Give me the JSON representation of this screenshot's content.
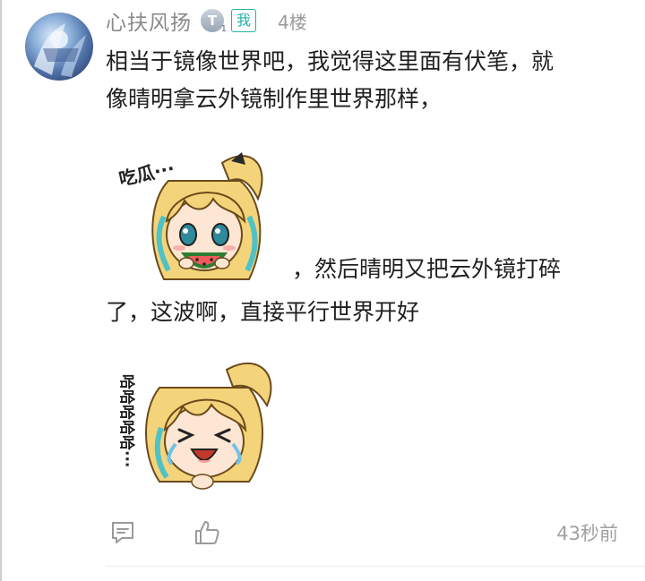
{
  "user": {
    "name": "心扶风扬",
    "level_letter": "T",
    "level_sub": "1",
    "me_tag": "我",
    "floor": "4楼"
  },
  "comment": {
    "line1": "相当于镜像世界吧，我觉得这里面有伏笔，就",
    "line2": "像晴明拿云外镜制作里世界那样，",
    "line3": "，然后晴明又把云外镜打碎",
    "line4": "了，这波啊，直接平行世界开好"
  },
  "stickers": [
    {
      "name": "eating-watermelon-sticker",
      "caption": "吃瓜···"
    },
    {
      "name": "laughing-sticker",
      "caption": "哈哈哈哈哈···"
    }
  ],
  "footer": {
    "comment_icon": "comment-icon",
    "like_icon": "thumbs-up-icon",
    "time": "43秒前"
  },
  "colors": {
    "accent": "#20b2a6",
    "username": "#8a8a8a",
    "meta": "#a0a0a0"
  }
}
